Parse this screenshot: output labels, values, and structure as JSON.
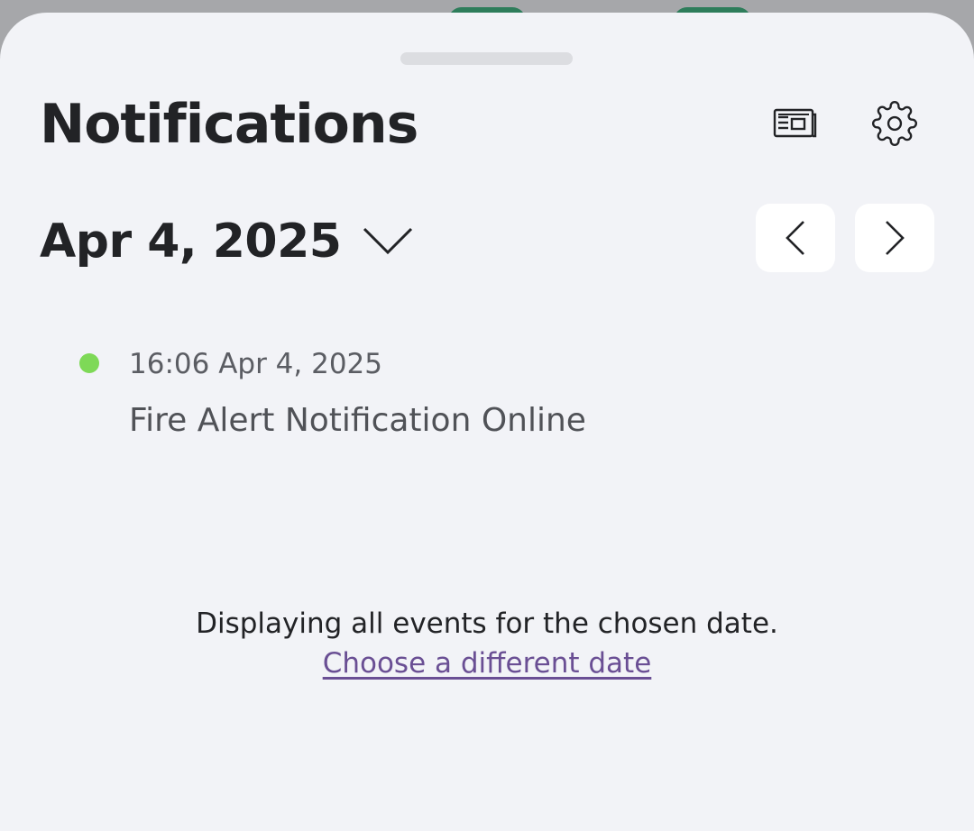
{
  "header": {
    "title": "Notifications",
    "icons": [
      "news-icon",
      "gear-icon"
    ]
  },
  "date_picker": {
    "selected_date": "Apr 4, 2025",
    "dropdown_icon": "chevron-down-icon",
    "prev_icon": "chevron-left-icon",
    "next_icon": "chevron-right-icon"
  },
  "events": [
    {
      "time": "16:06 Apr 4, 2025",
      "title": "Fire Alert Notification Online",
      "status_color": "#7ed957"
    }
  ],
  "footer": {
    "message": "Displaying all events for the chosen date.",
    "link": "Choose a different date"
  },
  "colors": {
    "sheet_background": "#f2f3f7",
    "link": "#6a4f94",
    "status_online": "#7ed957",
    "backdrop_accent": "#2e7d5b"
  }
}
